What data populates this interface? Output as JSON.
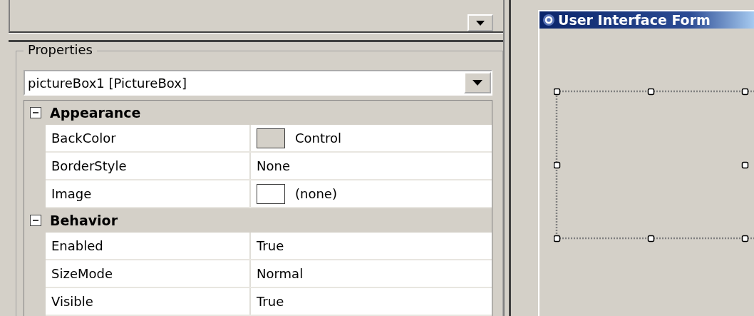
{
  "properties": {
    "title": "Properties",
    "object_selector": "pictureBox1 [PictureBox]",
    "categories": [
      {
        "name": "Appearance",
        "expanded": true,
        "rows": [
          {
            "name": "BackColor",
            "value": "Control",
            "kind": "swatch",
            "color": "#d4d0c8"
          },
          {
            "name": "BorderStyle",
            "value": "None",
            "kind": "text"
          },
          {
            "name": "Image",
            "value": "(none)",
            "kind": "swatch",
            "color": "#ffffff"
          }
        ]
      },
      {
        "name": "Behavior",
        "expanded": true,
        "rows": [
          {
            "name": "Enabled",
            "value": "True",
            "kind": "text"
          },
          {
            "name": "SizeMode",
            "value": "Normal",
            "kind": "text"
          },
          {
            "name": "Visible",
            "value": "True",
            "kind": "text"
          }
        ]
      }
    ]
  },
  "designer": {
    "form_title": "User Interface Form",
    "control_selected": true
  }
}
